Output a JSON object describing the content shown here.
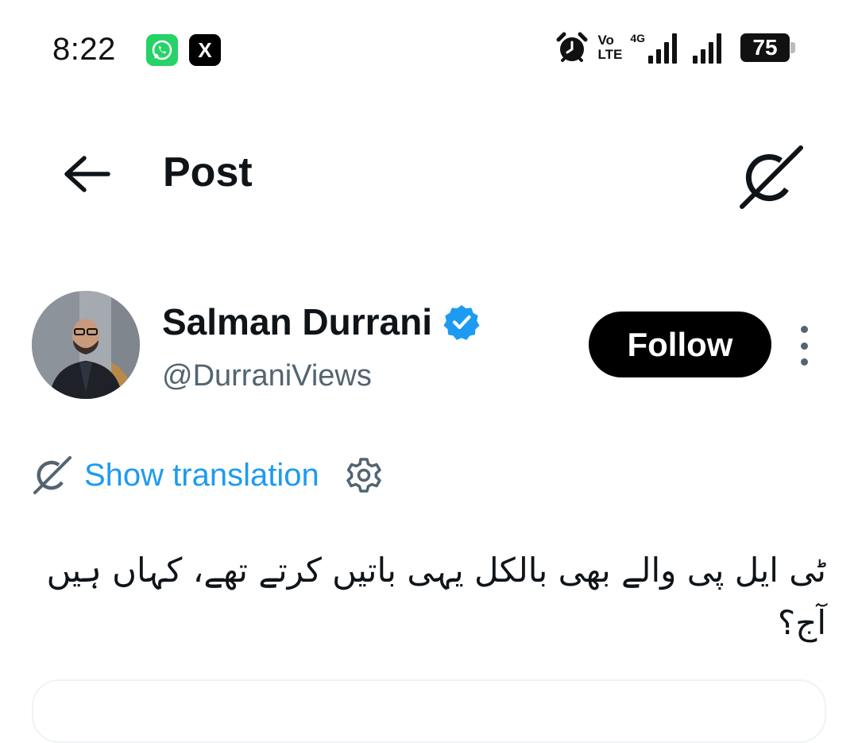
{
  "status_bar": {
    "time": "8:22",
    "notification_icons": [
      "whatsapp-icon",
      "x-icon"
    ],
    "x_glyph": "X",
    "volte_top": "Vo",
    "volte_bottom": "LTE",
    "network_type": "4G",
    "battery_level": "75",
    "battery_percent": 75
  },
  "header": {
    "title": "Post",
    "back_icon": "arrow-left-icon",
    "grok_icon": "grok-icon"
  },
  "author": {
    "name": "Salman Durrani",
    "handle": "@DurraniViews",
    "verified": true,
    "follow_label": "Follow"
  },
  "post": {
    "translate_label": "Show translation",
    "text": "ٹی ایل پی والے بھی بالکل یہی باتیں کرتے تھے، کہاں ہیں آج؟"
  },
  "colors": {
    "accent": "#1d9bf0",
    "text_primary": "#0f1419",
    "text_secondary": "#536471",
    "follow_bg": "#000000",
    "whatsapp": "#25d366"
  }
}
